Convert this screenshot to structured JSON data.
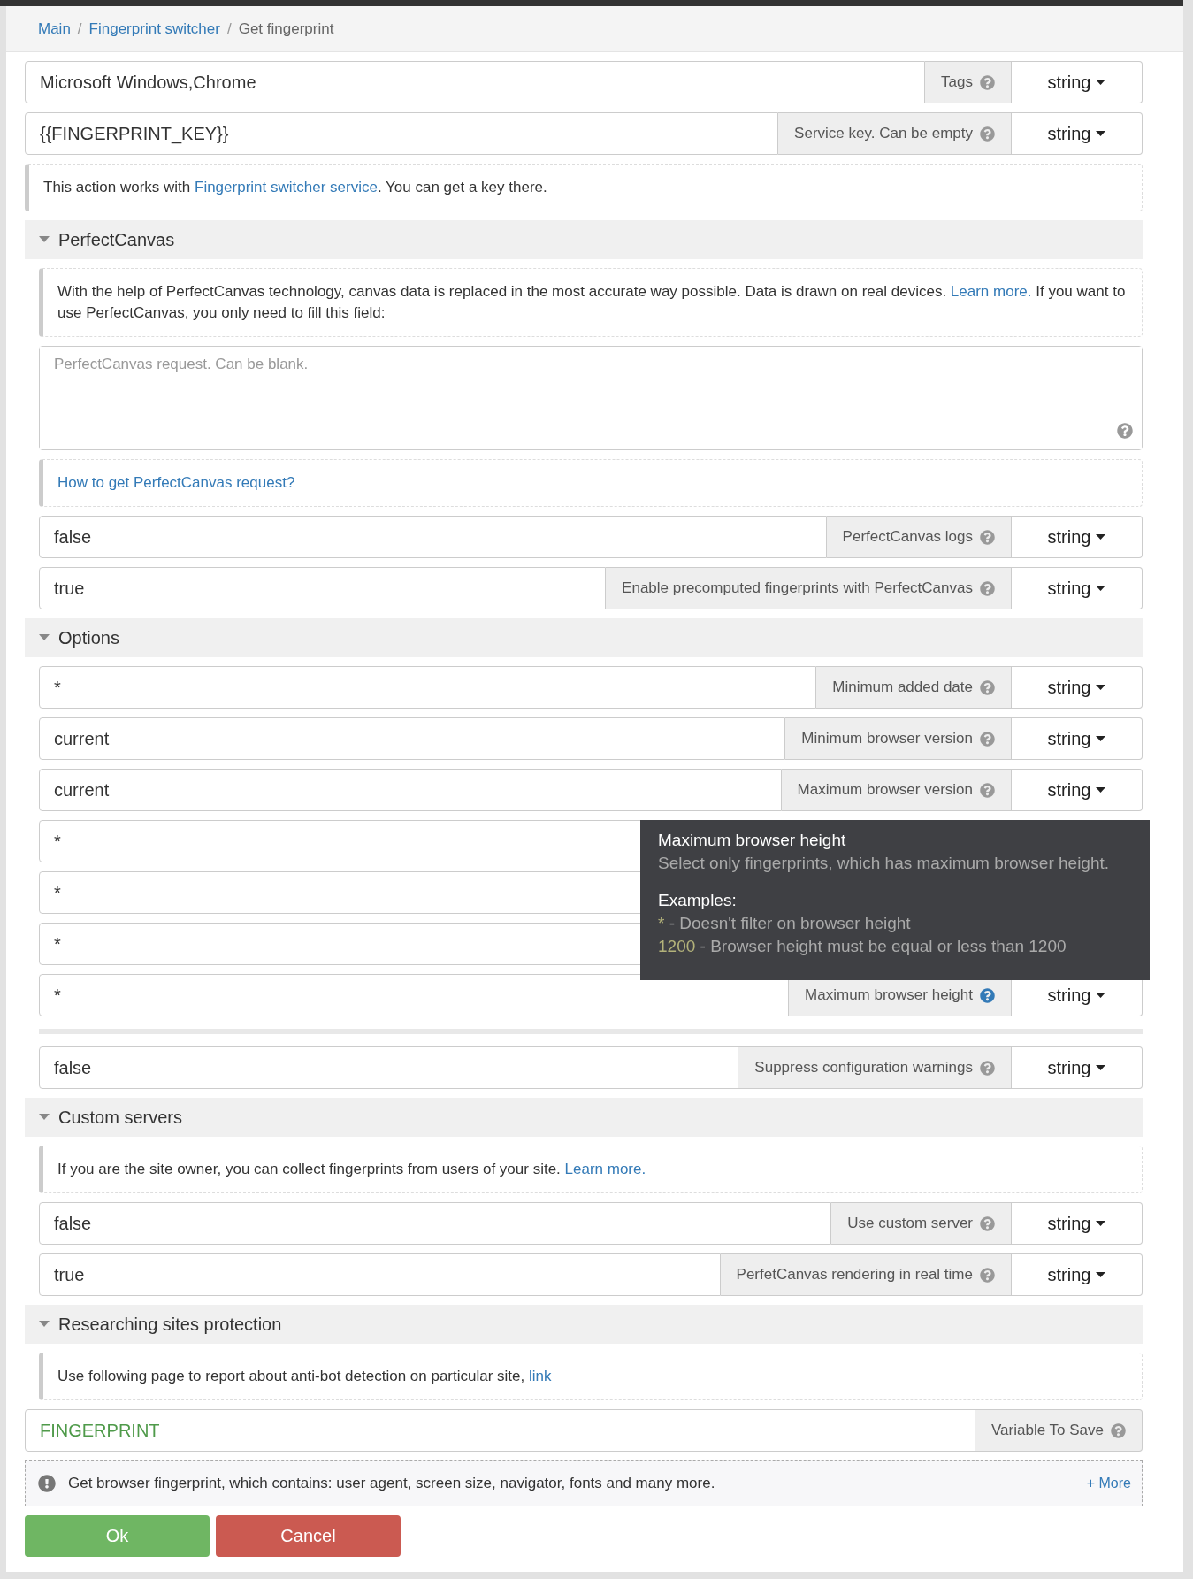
{
  "breadcrumb": [
    {
      "label": "Main",
      "link": true
    },
    {
      "separator": "/",
      "label": "Fingerprint switcher",
      "link": true
    },
    {
      "separator": "/",
      "label": "Get fingerprint",
      "link": false
    }
  ],
  "top_fields": [
    {
      "kind": "field",
      "value": "Microsoft Windows,Chrome",
      "label": "Tags",
      "type": "string",
      "help_active": false
    },
    {
      "kind": "field",
      "value": "{{FINGERPRINT_KEY}}",
      "label": "Service key. Can be empty",
      "type": "string",
      "help_active": false
    },
    {
      "kind": "note",
      "before": "This action works with ",
      "link": "Fingerprint switcher service",
      "after": ". You can get a key there."
    }
  ],
  "sections": [
    {
      "title": "PerfectCanvas",
      "expanded": true,
      "items": [
        {
          "kind": "note",
          "before": "With the help of PerfectCanvas technology, canvas data is replaced in the most accurate way possible. Data is drawn on real devices. ",
          "link": "Learn more.",
          "after": " If you want to use PerfectCanvas, you only need to fill this field:"
        },
        {
          "kind": "textarea",
          "placeholder": "PerfectCanvas request. Can be blank."
        },
        {
          "kind": "note",
          "link": "How to get PerfectCanvas request?"
        },
        {
          "kind": "field",
          "value": "false",
          "label": "PerfectCanvas logs",
          "type": "string",
          "help_active": false
        },
        {
          "kind": "field",
          "value": "true",
          "label": "Enable precomputed fingerprints with PerfectCanvas",
          "type": "string",
          "help_active": false
        }
      ]
    },
    {
      "title": "Options",
      "expanded": true,
      "items": [
        {
          "kind": "field",
          "value": "*",
          "label": "Minimum added date",
          "type": "string",
          "help_active": false
        },
        {
          "kind": "field",
          "value": "current",
          "label": "Minimum browser version",
          "type": "string",
          "help_active": false
        },
        {
          "kind": "field",
          "value": "current",
          "label": "Maximum browser version",
          "type": "string",
          "help_active": false
        },
        {
          "kind": "covered",
          "value": "*"
        },
        {
          "kind": "covered",
          "value": "*"
        },
        {
          "kind": "covered",
          "value": "*"
        },
        {
          "kind": "field",
          "value": "*",
          "label": "Maximum browser height",
          "type": "string",
          "help_active": true
        },
        {
          "kind": "divider"
        },
        {
          "kind": "field",
          "value": "false",
          "label": "Suppress configuration warnings",
          "type": "string",
          "help_active": false
        }
      ]
    },
    {
      "title": "Custom servers",
      "expanded": true,
      "items": [
        {
          "kind": "note",
          "before": "If you are the site owner, you can collect fingerprints from users of your site. ",
          "link": "Learn more."
        },
        {
          "kind": "field",
          "value": "false",
          "label": "Use custom server",
          "type": "string",
          "help_active": false
        },
        {
          "kind": "field",
          "value": "true",
          "label": "PerfetCanvas rendering in real time",
          "type": "string",
          "help_active": false
        }
      ]
    },
    {
      "title": "Researching sites protection",
      "expanded": true,
      "items": [
        {
          "kind": "note",
          "before": "Use following page to report about anti-bot detection on particular site, ",
          "link": "link"
        }
      ]
    }
  ],
  "output": {
    "value": "FINGERPRINT",
    "label": "Variable To Save",
    "help_active": false
  },
  "description": {
    "text": "Get browser fingerprint, which contains: user agent, screen size, navigator, fonts and many more.",
    "more": "+ More"
  },
  "buttons": [
    {
      "label": "Ok",
      "kind": "ok"
    },
    {
      "label": "Cancel",
      "kind": "cancel"
    }
  ],
  "tooltip": {
    "title": "Maximum browser height",
    "description": "Select only fingerprints, which has maximum browser height.",
    "examples_heading": "Examples:",
    "examples": [
      {
        "code": "*",
        "text": " - Doesn't filter on browser height"
      },
      {
        "code": "1200",
        "text": " - Browser height must be equal or less than 1200"
      }
    ]
  }
}
